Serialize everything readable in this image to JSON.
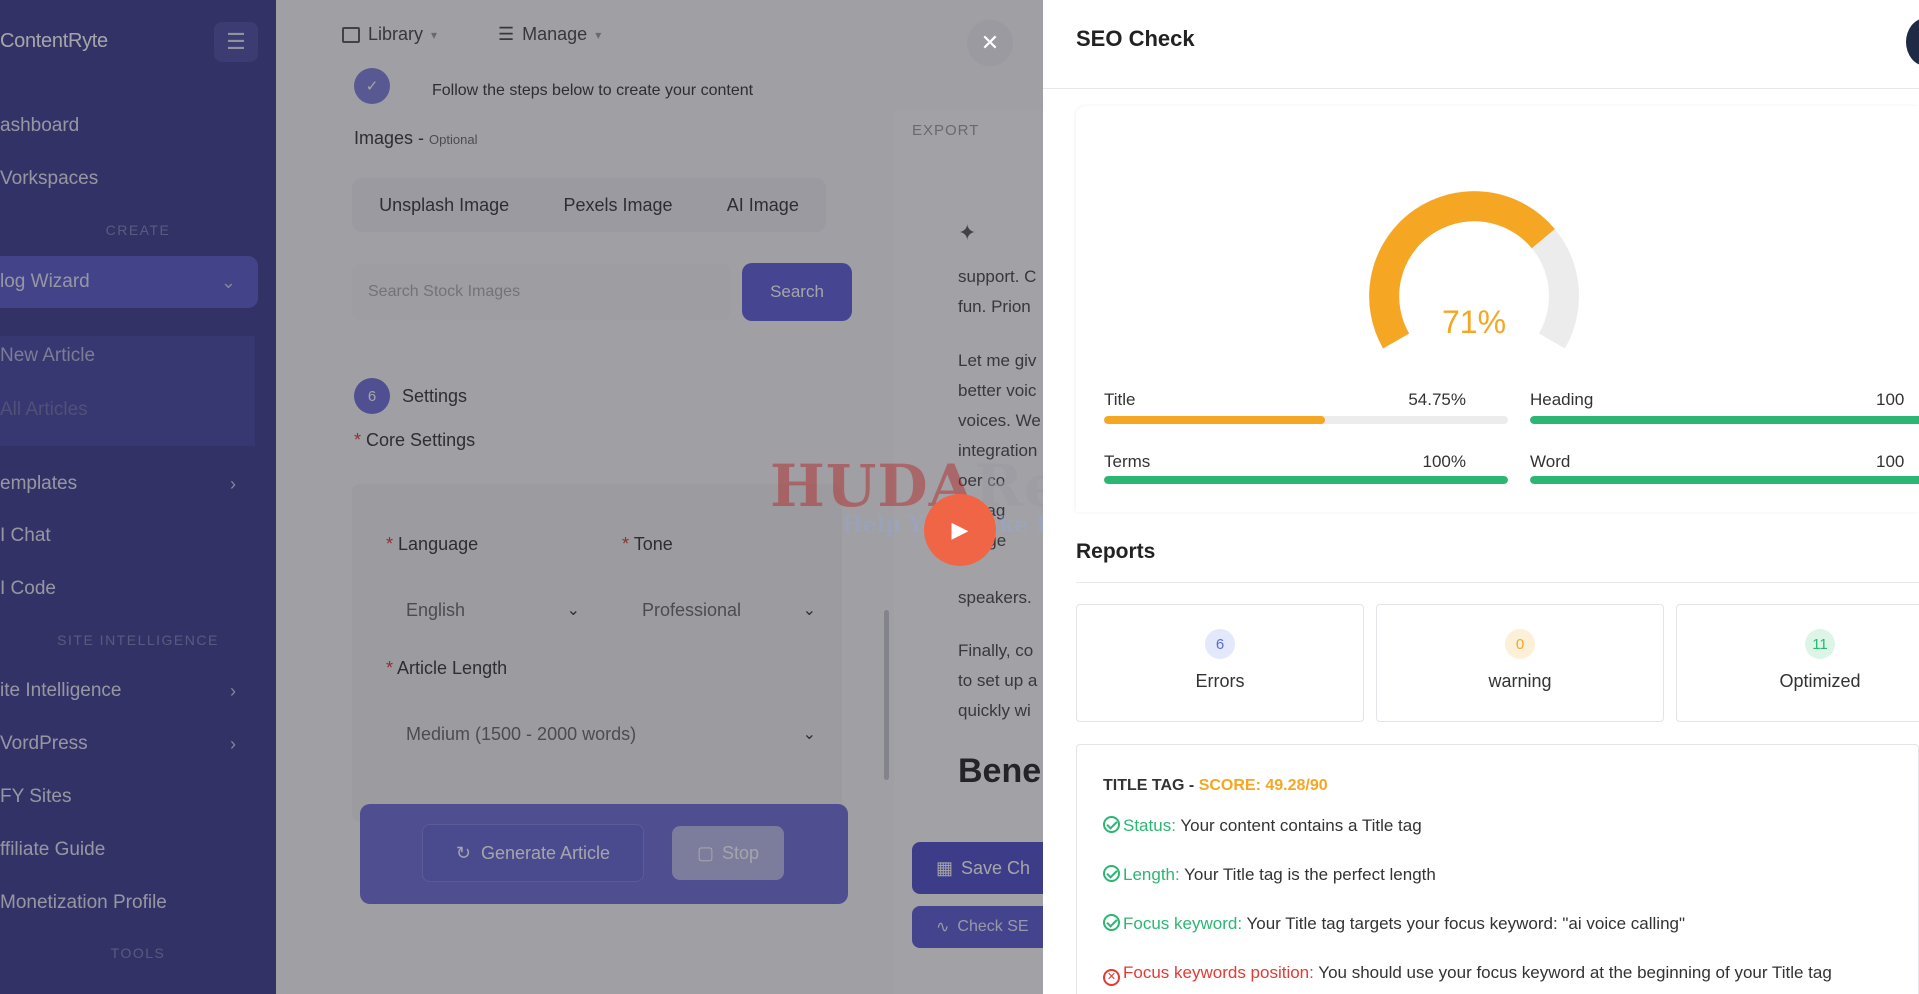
{
  "sidebar": {
    "logo": "ContentRyte",
    "items": [
      {
        "label": "ashboard"
      },
      {
        "label": "Vorkspaces"
      },
      {
        "label": "log Wizard"
      },
      {
        "label": "New Article"
      },
      {
        "label": "All Articles"
      },
      {
        "label": "emplates"
      },
      {
        "label": "I Chat"
      },
      {
        "label": "I Code"
      },
      {
        "label": "ite Intelligence"
      },
      {
        "label": "VordPress"
      },
      {
        "label": "FY Sites"
      },
      {
        "label": "ffiliate Guide"
      },
      {
        "label": "Monetization Profile"
      }
    ],
    "sections": {
      "create": "CREATE",
      "site_intelligence": "SITE INTELLIGENCE",
      "tools": "TOOLS"
    }
  },
  "topbar": {
    "library": "Library",
    "manage": "Manage"
  },
  "form": {
    "step_hint": "Follow the steps below to create your content",
    "images_label": "Images -",
    "images_optional": "Optional",
    "image_tabs": [
      "Unsplash Image",
      "Pexels Image",
      "AI Image"
    ],
    "search_placeholder": "Search Stock Images",
    "search_button": "Search",
    "step_number": "6",
    "settings_title": "Settings",
    "core_settings": "Core Settings",
    "language_label": "Language",
    "language_value": "English",
    "tone_label": "Tone",
    "tone_value": "Professional",
    "length_label": "Article Length",
    "length_value": "Medium (1500 - 2000 words)",
    "generate_button": "Generate Article",
    "stop_button": "Stop",
    "required_mark": "*"
  },
  "editor": {
    "export": "EXPORT",
    "lines": [
      "support. C",
      "fun. Prion",
      "Let me giv",
      "better voic",
      "voices. We",
      "integration",
      "oer co",
      "nguag",
      "ar age",
      "speakers.",
      "Finally, co",
      "to set up a",
      "quickly wi"
    ],
    "heading": "Bene",
    "save_button": "Save Ch",
    "check_button": "Check SE"
  },
  "watermark": {
    "line1a": "HUDA",
    "line1b": "Review",
    "line2": "Help You Make Better Decisions"
  },
  "seo": {
    "title": "SEO Check",
    "score_text": "71%",
    "score_value": 71,
    "metrics": [
      {
        "label": "Title",
        "value": "54.75%",
        "pct": 54.75,
        "color": "#f5a623"
      },
      {
        "label": "Heading",
        "value": "100",
        "pct": 100,
        "color": "#2bb673"
      },
      {
        "label": "Terms",
        "value": "100%",
        "pct": 100,
        "color": "#2bb673"
      },
      {
        "label": "Word",
        "value": "100",
        "pct": 100,
        "color": "#2bb673"
      }
    ],
    "reports_title": "Reports",
    "report_cards": [
      {
        "count": "6",
        "label": "Errors",
        "bg": "#e3e8fb",
        "fg": "#5b6dd6"
      },
      {
        "count": "0",
        "label": "warning",
        "bg": "#fdf0d9",
        "fg": "#f5a623"
      },
      {
        "count": "11",
        "label": "Optimized",
        "bg": "#dcf5e7",
        "fg": "#2bb673"
      }
    ],
    "detail": {
      "heading": "TITLE TAG -",
      "score": "SCORE: 49.28/90",
      "lines": [
        {
          "key": "Status:",
          "text": "Your content contains a Title tag",
          "ok": true
        },
        {
          "key": "Length:",
          "text": "Your Title tag is the perfect length",
          "ok": true
        },
        {
          "key": "Focus keyword:",
          "text": "Your Title tag targets your focus keyword: \"ai voice calling\"",
          "ok": true
        },
        {
          "key": "Focus keywords position:",
          "text": "You should use your focus keyword at the beginning of your Title tag",
          "ok": false
        }
      ]
    }
  },
  "colors": {
    "sidebar": "#3a3a8c",
    "accent": "#5b5bd6",
    "orange": "#f5a623",
    "green": "#2bb673",
    "red": "#e53935"
  }
}
